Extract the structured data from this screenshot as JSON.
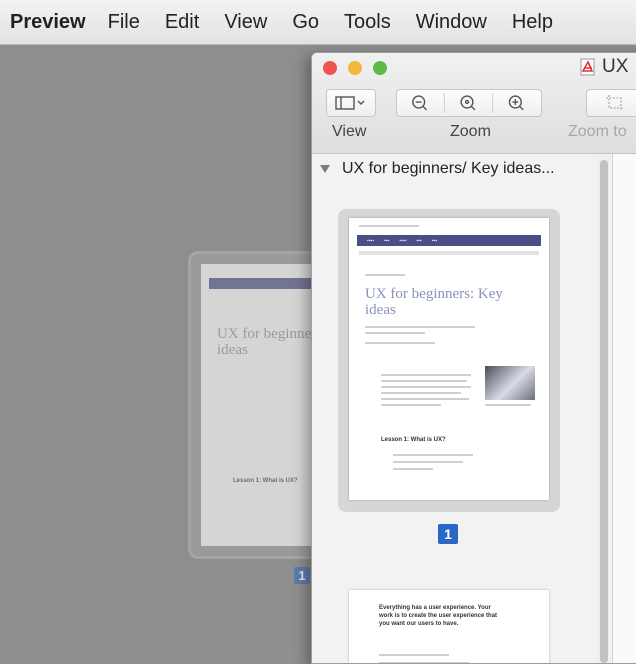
{
  "menubar": {
    "app_name": "Preview",
    "items": [
      "File",
      "Edit",
      "View",
      "Go",
      "Tools",
      "Window",
      "Help"
    ]
  },
  "window": {
    "title": "UX",
    "toolbar": {
      "view_label": "View",
      "zoom_label": "Zoom",
      "zoom_to_label": "Zoom to"
    }
  },
  "sidebar": {
    "document_title": "UX for beginners/ Key ideas...",
    "pages": [
      {
        "number": "1",
        "heading": "UX for beginners: Key ideas",
        "subheading": "Lesson 1: What is UX?"
      },
      {
        "number": "",
        "heading": "Everything has a user experience. Your work is to create the user experience that you want our users to have."
      }
    ]
  },
  "drag_ghost": {
    "page_number": "1"
  },
  "colors": {
    "selected_badge": "#2a66c4",
    "ghost_badge": "#5d7cab",
    "nav_purple": "#4a4e86",
    "close": "#ef5650",
    "minimize": "#f3b73a",
    "zoom": "#5bbd47"
  }
}
